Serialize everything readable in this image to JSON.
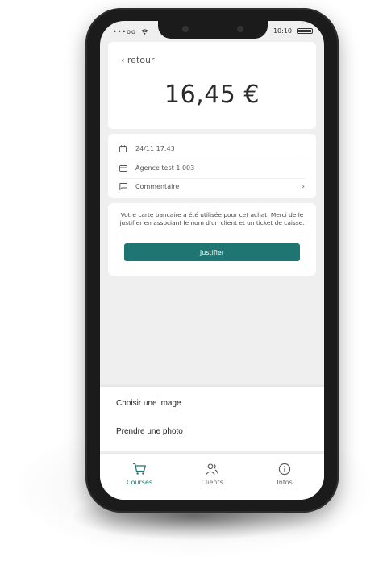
{
  "status_bar": {
    "carrier": "•••oo",
    "time": "10:10"
  },
  "header": {
    "back_label": "‹ retour",
    "amount": "16,45 €"
  },
  "details": {
    "date": "24/11 17:43",
    "agency": "Agence test 1 003",
    "comment_label": "Commentaire",
    "comment_chevron": "›"
  },
  "justify": {
    "message": "Votre carte bancaire a été utilisée pour cet achat. Merci de le justifier en associant le nom d'un client et un ticket de caisse.",
    "button_label": "Justifier"
  },
  "sheet": {
    "items": [
      {
        "label": "Choisir une image"
      },
      {
        "label": "Prendre une photo"
      }
    ]
  },
  "tabs": [
    {
      "label": "Courses",
      "icon": "cart-icon",
      "active": true
    },
    {
      "label": "Clients",
      "icon": "users-icon",
      "active": false
    },
    {
      "label": "Infos",
      "icon": "info-icon",
      "active": false
    }
  ],
  "colors": {
    "accent": "#1e7571",
    "background": "#efefef"
  }
}
